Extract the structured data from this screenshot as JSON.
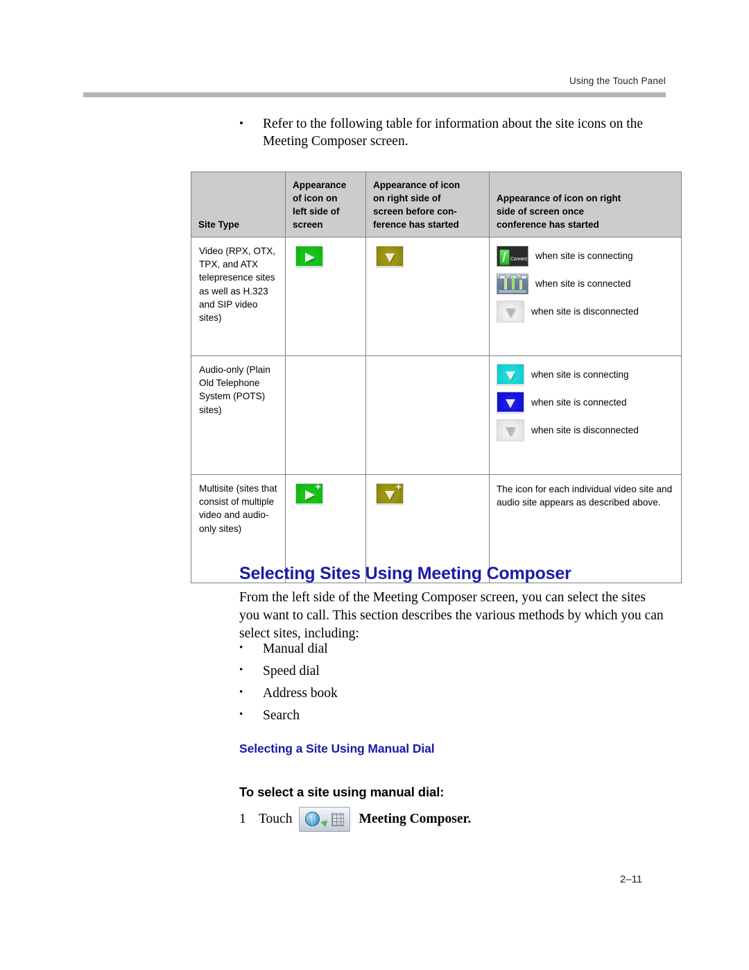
{
  "header": {
    "running_head": "Using the Touch Panel"
  },
  "intro": {
    "bullet_mark": "•",
    "text": "Refer to the following table for information about the site icons on the Meeting Composer screen."
  },
  "table": {
    "columns": [
      "Site Type",
      "Appearance of icon on left side of screen",
      "Appearance of icon on right side of screen before conference has started",
      "Appearance of icon on right side of screen once conference has started"
    ],
    "column_lines": {
      "site_type": [
        "Site Type"
      ],
      "left_side": [
        "Appearance",
        "of icon on",
        "left side of",
        "screen"
      ],
      "before_conf": [
        "Appearance of icon",
        "on right side of",
        "screen before con-",
        "ference has started"
      ],
      "once_conf": [
        "Appearance of icon on right",
        "side of screen once",
        "conference has started"
      ]
    },
    "rows": [
      {
        "site_type": "Video (RPX, OTX, TPX, and ATX telepresence sites as well as H.323 and SIP video sites)",
        "left_icon": "video-site-green-icon",
        "before_icon": "video-site-olive-icon",
        "states": [
          {
            "icon": "connect-button-thumbnail",
            "caption": "when site is connecting"
          },
          {
            "icon": "connected-room-thumbnail",
            "caption": "when site is connected"
          },
          {
            "icon": "disconnected-gray-icon",
            "caption": "when site is disconnected"
          }
        ]
      },
      {
        "site_type": "Audio-only (Plain Old Telephone System (POTS) sites)",
        "left_icon": null,
        "before_icon": null,
        "states": [
          {
            "icon": "audio-connecting-cyan-icon",
            "caption": "when site is connecting"
          },
          {
            "icon": "audio-connected-blue-icon",
            "caption": "when site is connected"
          },
          {
            "icon": "audio-disconnected-gray-icon",
            "caption": "when site is disconnected"
          }
        ]
      },
      {
        "site_type": "Multisite (sites that consist of multiple video and audio-only sites)",
        "left_icon": "multisite-green-plus-icon",
        "before_icon": "multisite-olive-plus-icon",
        "note": "The icon for each individual video site and audio site appears as described above."
      }
    ]
  },
  "section": {
    "heading": "Selecting Sites Using Meeting Composer",
    "paragraph": "From the left side of the Meeting Composer screen, you can select the sites you want to call. This section describes the various methods by which you can select sites, including:",
    "bullet_mark": "•",
    "bullets": [
      "Manual dial",
      "Speed dial",
      "Address book",
      "Search"
    ],
    "subheading": "Selecting a Site Using Manual Dial",
    "procedure_title": "To select a site using manual dial:",
    "step": {
      "number": "1",
      "before_icon": "Touch",
      "icon": "meeting-composer-button-icon",
      "after_icon": "Meeting Composer."
    }
  },
  "footer": {
    "page_number": "2–11"
  },
  "colors": {
    "heading_blue": "#1a1aa8",
    "header_rule": "#b3b3b3",
    "table_header_fill": "#cccccc",
    "table_border": "#808080"
  }
}
